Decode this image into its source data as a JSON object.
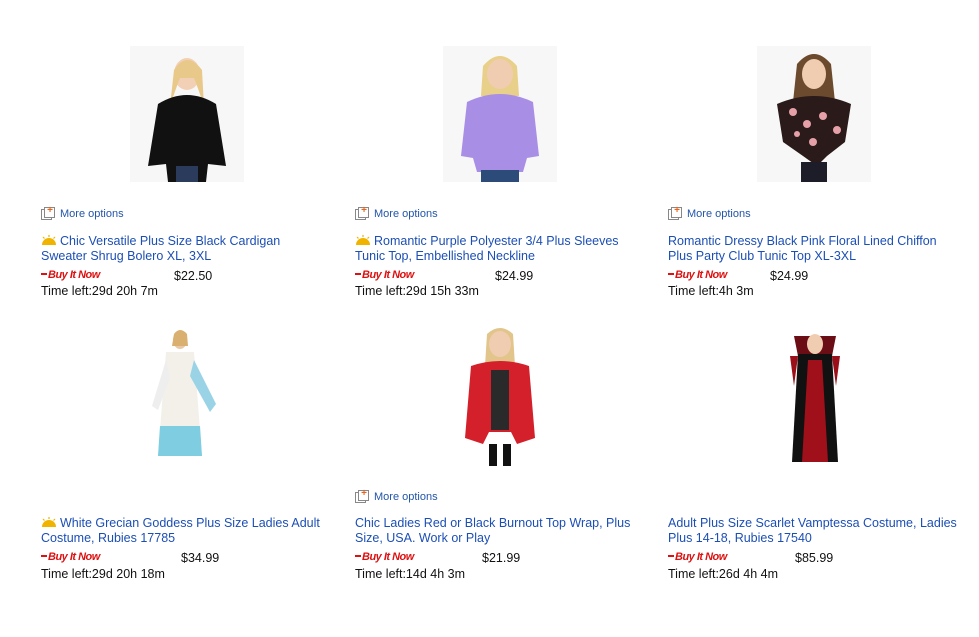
{
  "listings": [
    {
      "title": "Chic Versatile Plus Size Black Cardigan Sweater Shrug Bolero XL, 3XL",
      "hot": true,
      "more_options": "More options",
      "buy_it_now": "Buy It Now",
      "price": "$22.50",
      "time_left": "Time left:29d 20h 7m",
      "image": "woman-black-cardigan"
    },
    {
      "title": "Romantic Purple Polyester 3/4 Plus Sleeves Tunic Top, Embellished Neckline",
      "hot": true,
      "more_options": "More options",
      "buy_it_now": "Buy It Now",
      "price": "$24.99",
      "time_left": "Time left:29d 15h 33m",
      "image": "woman-purple-tunic"
    },
    {
      "title": "Romantic Dressy Black Pink Floral Lined Chiffon Plus Party Club Tunic Top XL-3XL",
      "hot": false,
      "more_options": "More options",
      "buy_it_now": "Buy It Now",
      "price": "$24.99",
      "time_left": "Time left:4h 3m",
      "image": "woman-floral-tunic"
    },
    {
      "title": "White Grecian Goddess Plus Size Ladies Adult Costume, Rubies 17785",
      "hot": true,
      "more_options": "",
      "buy_it_now": "Buy It Now",
      "price": "$34.99",
      "time_left": "Time left:29d 20h 18m",
      "image": "white-grecian-costume"
    },
    {
      "title": "Chic Ladies Red or Black Burnout Top Wrap, Plus Size, USA. Work or Play",
      "hot": false,
      "more_options": "More options",
      "buy_it_now": "Buy It Now",
      "price": "$21.99",
      "time_left": "Time left:14d 4h 3m",
      "image": "woman-red-wrap"
    },
    {
      "title": "Adult Plus Size Scarlet Vamptessa Costume, Ladies Plus 14-18, Rubies 17540",
      "hot": false,
      "more_options": "",
      "buy_it_now": "Buy It Now",
      "price": "$85.99",
      "time_left": "Time left:26d 4h 4m",
      "image": "scarlet-vamptessa-costume"
    }
  ],
  "colors": {
    "link": "#1c4fb5",
    "bin": "#dd1111",
    "hot": "#f0b400"
  }
}
